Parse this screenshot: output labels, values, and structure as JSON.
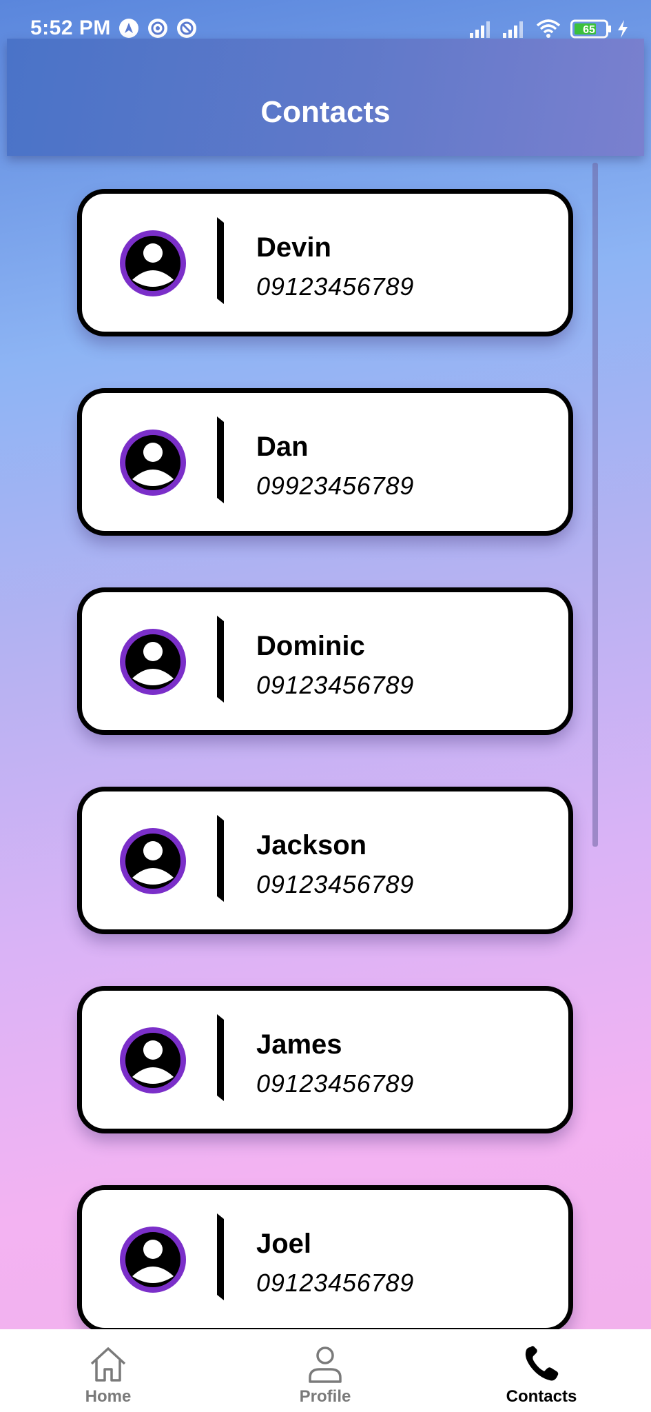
{
  "status_bar": {
    "time": "5:52 PM",
    "battery": "65"
  },
  "app_bar": {
    "title": "Contacts"
  },
  "contacts": [
    {
      "name": "Devin",
      "phone": "09123456789"
    },
    {
      "name": "Dan",
      "phone": "09923456789"
    },
    {
      "name": "Dominic",
      "phone": "09123456789"
    },
    {
      "name": "Jackson",
      "phone": "09123456789"
    },
    {
      "name": "James",
      "phone": "09123456789"
    },
    {
      "name": "Joel",
      "phone": "09123456789"
    }
  ],
  "bottom_nav": {
    "items": [
      {
        "label": "Home",
        "icon": "home-icon",
        "active": false
      },
      {
        "label": "Profile",
        "icon": "person-icon",
        "active": false
      },
      {
        "label": "Contacts",
        "icon": "phone-icon",
        "active": true
      }
    ]
  },
  "colors": {
    "avatar_ring": "#7b2fc9",
    "nav_active": "#000000",
    "nav_inactive": "#7a7a7a"
  }
}
